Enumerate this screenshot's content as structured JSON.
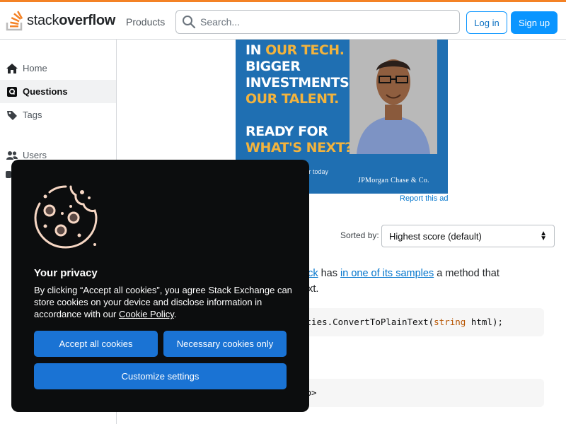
{
  "header": {
    "logo_prefix": "stack",
    "logo_suffix": "overflow",
    "products_label": "Products",
    "search_placeholder": "Search...",
    "login_label": "Log in",
    "signup_label": "Sign up",
    "accent_color": "#f48225"
  },
  "sidebar": {
    "items": [
      {
        "label": "Home",
        "icon": "home-icon"
      },
      {
        "label": "Questions",
        "icon": "questions-icon",
        "active": true
      },
      {
        "label": "Tags",
        "icon": "tag-icon"
      },
      {
        "label": "Users",
        "icon": "users-icon"
      }
    ]
  },
  "ad": {
    "lines": [
      "IN OUR TECH.",
      "BIGGER",
      "INVESTMENTS IN",
      "OUR TALENT.",
      "READY FOR",
      "WHAT'S NEXT?"
    ],
    "footnote": "ter today",
    "brand": "JPMorgan Chase & Co.",
    "report_label": "Report this ad"
  },
  "answers": {
    "sorted_label": "Sorted by:",
    "sort_value": "Highest score (default)"
  },
  "content": {
    "para_link1": "ack",
    "para_text1": " has ",
    "para_link2": "in one of its samples",
    "para_text2": " a method that",
    "para_line2": "ext.",
    "code1_pre": "ities.ConvertToPlainText(",
    "code1_kw": "string",
    "code1_post": " html);",
    "code2": "/b>"
  },
  "cookie": {
    "title": "Your privacy",
    "body_text": "By clicking “Accept all cookies”, you agree Stack Exchange can store cookies on your device and disclose information in accordance with our ",
    "policy_link": "Cookie Policy",
    "body_end": ".",
    "accept_all": "Accept all cookies",
    "necessary_only": "Necessary cookies only",
    "customize": "Customize settings",
    "button_color": "#1a73d4"
  }
}
